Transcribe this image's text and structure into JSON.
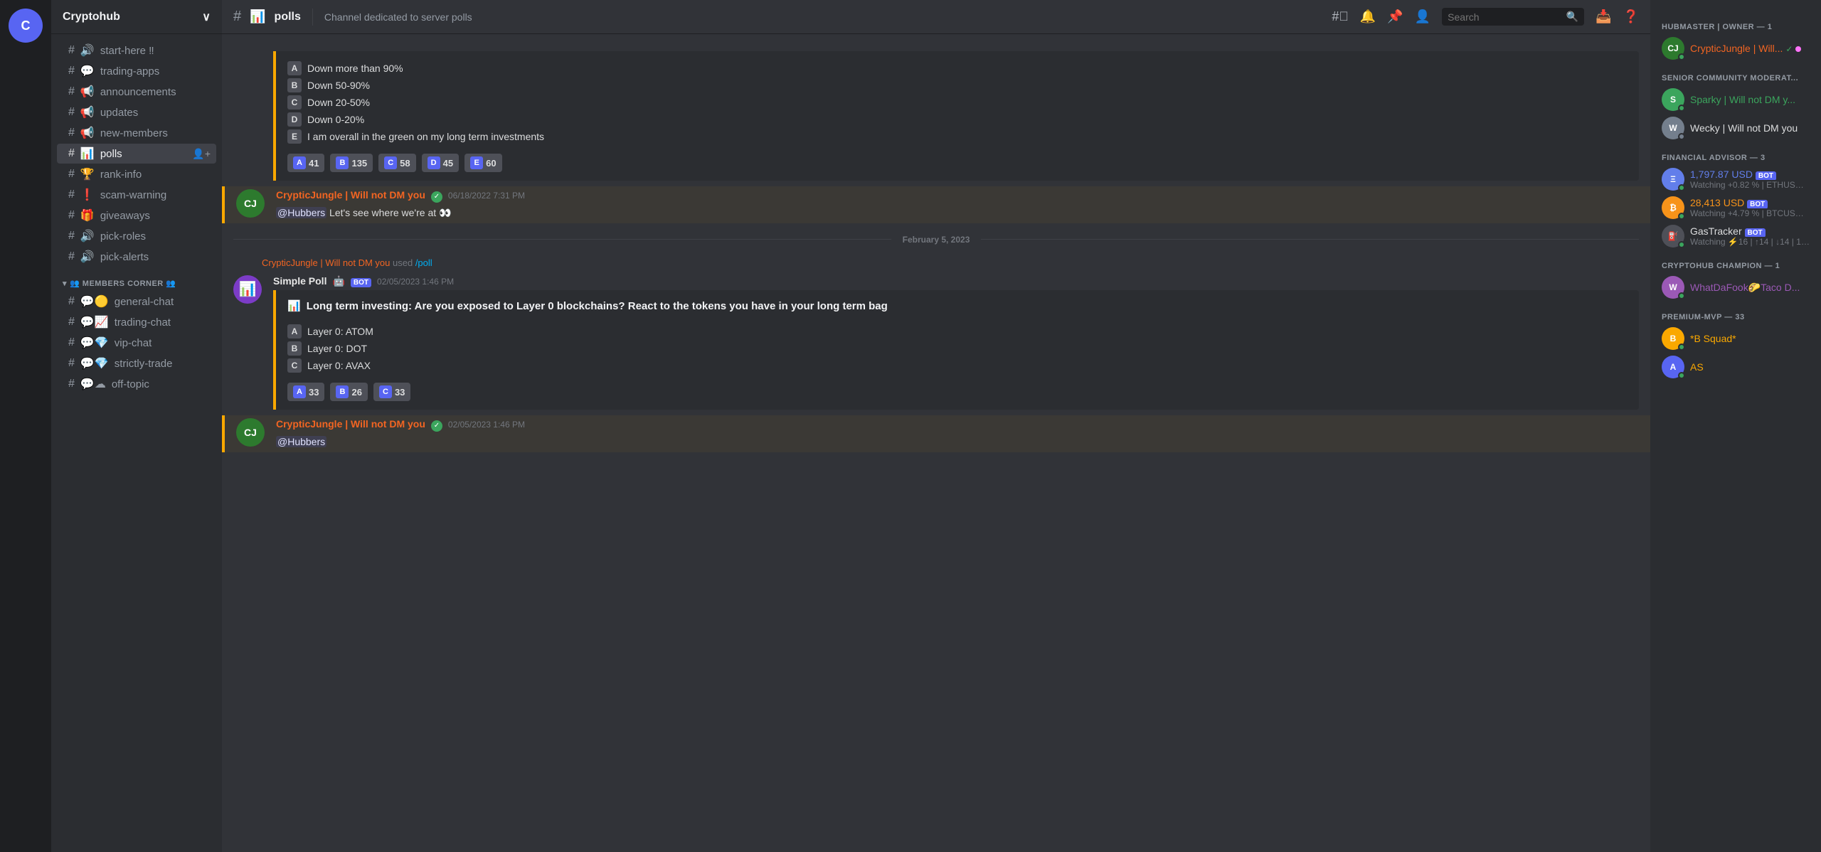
{
  "server": {
    "name": "Cryptohub",
    "icon": "C"
  },
  "channel": {
    "name": "polls",
    "icon": "📊",
    "description": "Channel dedicated to server polls"
  },
  "sidebar": {
    "channels": [
      {
        "name": "start-here",
        "emoji": "🔊",
        "suffix": "‼",
        "id": "start-here"
      },
      {
        "name": "trading-apps",
        "emoji": "💬",
        "id": "trading-apps"
      },
      {
        "name": "announcements",
        "emoji": "📢",
        "id": "announcements"
      },
      {
        "name": "updates",
        "emoji": "📢",
        "id": "updates"
      },
      {
        "name": "new-members",
        "emoji": "📢",
        "id": "new-members"
      },
      {
        "name": "polls",
        "emoji": "📊",
        "id": "polls",
        "active": true
      },
      {
        "name": "rank-info",
        "emoji": "🏆",
        "id": "rank-info"
      },
      {
        "name": "scam-warning",
        "emoji": "❗",
        "id": "scam-warning"
      },
      {
        "name": "giveaways",
        "emoji": "🎁",
        "id": "giveaways"
      },
      {
        "name": "pick-roles",
        "emoji": "🔊",
        "id": "pick-roles"
      },
      {
        "name": "pick-alerts",
        "emoji": "🔊",
        "id": "pick-alerts"
      }
    ],
    "members_corner_channels": [
      {
        "name": "general-chat",
        "emoji": "💬🟡",
        "id": "general-chat"
      },
      {
        "name": "trading-chat",
        "emoji": "💬📈",
        "id": "trading-chat"
      },
      {
        "name": "vip-chat",
        "emoji": "💬💎",
        "id": "vip-chat"
      },
      {
        "name": "strictly-trade",
        "emoji": "💬💎",
        "id": "strictly-trade"
      },
      {
        "name": "off-topic",
        "emoji": "💬☁",
        "id": "off-topic"
      }
    ]
  },
  "messages": {
    "poll1": {
      "options": [
        {
          "letter": "A",
          "text": "Down more than 90%"
        },
        {
          "letter": "B",
          "text": "Down 50-90%"
        },
        {
          "letter": "C",
          "text": "Down 20-50%"
        },
        {
          "letter": "D",
          "text": "Down 0-20%"
        },
        {
          "letter": "E",
          "text": "I am overall in the green on my long term investments"
        }
      ],
      "votes": [
        {
          "letter": "A",
          "count": "41"
        },
        {
          "letter": "B",
          "count": "135"
        },
        {
          "letter": "C",
          "count": "58"
        },
        {
          "letter": "D",
          "count": "45"
        },
        {
          "letter": "E",
          "count": "60"
        }
      ]
    },
    "msg1": {
      "author": "CrypticJungle | Will not DM you",
      "badge": "✓",
      "timestamp": "06/18/2022 7:31 PM",
      "text": "@Hubbers Let's see where we're at 👀"
    },
    "date_divider": "February 5, 2023",
    "poll2_command": {
      "user": "CrypticJungle | Will not DM you",
      "command": "/poll"
    },
    "poll2": {
      "bot_name": "Simple Poll",
      "bot_timestamp": "02/05/2023 1:46 PM",
      "title": "Long term investing: Are you exposed to Layer 0 blockchains? React to the tokens you have in your long term bag",
      "options": [
        {
          "letter": "A",
          "text": "Layer 0: ATOM"
        },
        {
          "letter": "B",
          "text": "Layer 0: DOT"
        },
        {
          "letter": "C",
          "text": "Layer 0: AVAX"
        }
      ],
      "votes": [
        {
          "letter": "A",
          "count": "33"
        },
        {
          "letter": "B",
          "count": "26"
        },
        {
          "letter": "C",
          "count": "33"
        }
      ]
    },
    "msg2": {
      "author": "CrypticJungle | Will not DM you",
      "badge": "✓",
      "timestamp": "02/05/2023 1:46 PM",
      "text": "@Hubbers"
    }
  },
  "members": {
    "categories": [
      {
        "name": "HUBMASTER | OWNER — 1",
        "members": [
          {
            "name": "CrypticJungle | Will...",
            "status": "online",
            "color": "cryptic-name",
            "avatar_color": "#2d7a2e",
            "avatar_text": "CJ",
            "dot": "online"
          }
        ]
      },
      {
        "name": "SENIOR COMMUNITY MODERAT...",
        "members": [
          {
            "name": "Sparky | Will not DM y...",
            "status": "online",
            "color": "sparky-name",
            "avatar_color": "#3ba55d",
            "avatar_text": "S",
            "dot": "online"
          },
          {
            "name": "Wecky | Will not DM you",
            "status": "offline",
            "color": "wecky-name",
            "avatar_color": "#747f8d",
            "avatar_text": "W",
            "dot": "offline"
          }
        ]
      },
      {
        "name": "FINANCIAL ADVISOR — 3",
        "members": [
          {
            "name": "1,797.87 USD",
            "subtext": "Watching +0.82 % | ETHUSD |...",
            "color": "eth-name",
            "avatar_color": "#627eea",
            "avatar_text": "Ξ",
            "is_bot": true
          },
          {
            "name": "28,413 USD",
            "subtext": "Watching +4.79 % | BTCUSD |...",
            "color": "btc-name",
            "avatar_color": "#f7931a",
            "avatar_text": "₿",
            "is_bot": true
          },
          {
            "name": "GasTracker",
            "subtext": "Watching ⚡16 | ↑14 | ↓14 | 1h...",
            "color": "gas-name",
            "avatar_color": "#4e5058",
            "avatar_text": "⛽",
            "is_bot": true
          }
        ]
      },
      {
        "name": "CRYPTOHUB CHAMPION — 1",
        "members": [
          {
            "name": "WhatDaFook🌮Taco D...",
            "status": "online",
            "color": "champion-name",
            "avatar_color": "#9b59b6",
            "avatar_text": "W",
            "dot": "online"
          }
        ]
      },
      {
        "name": "PREMIUM-MVP — 33",
        "members": [
          {
            "name": "*B Squad*",
            "status": "online",
            "color": "premium-name",
            "avatar_color": "#faa800",
            "avatar_text": "B",
            "dot": "online"
          },
          {
            "name": "AS",
            "status": "online",
            "color": "premium-name",
            "avatar_color": "#5865f2",
            "avatar_text": "A",
            "dot": "online"
          }
        ]
      }
    ]
  },
  "ui": {
    "search_placeholder": "Search",
    "members_corner_category": "MEMBERS CORNER",
    "server_chevron": "∨"
  }
}
